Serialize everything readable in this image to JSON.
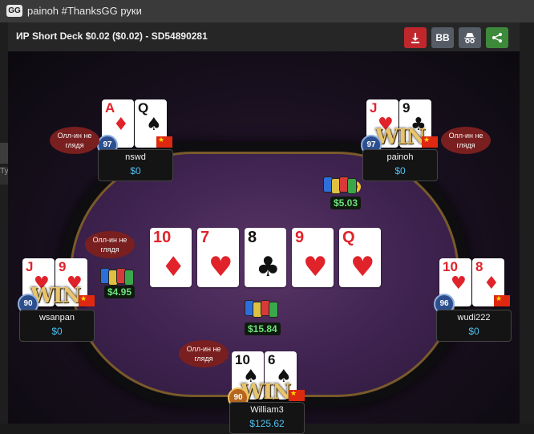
{
  "window": {
    "title": "painoh #ThanksGG руки",
    "logo_text": "GG"
  },
  "left_strip_fragment": "Ту",
  "toolbar": {
    "table_info": "ИР  Short Deck $0.02 ($0.02)   - SD54890281",
    "buttons": {
      "download_icon": "download-icon",
      "bb_label": "BB",
      "anon_icon": "incognito-icon",
      "share_icon": "share-icon"
    }
  },
  "board": [
    {
      "rank": "10",
      "suit": "♦",
      "color": "red"
    },
    {
      "rank": "7",
      "suit": "♥",
      "color": "red"
    },
    {
      "rank": "8",
      "suit": "♣",
      "color": "black"
    },
    {
      "rank": "9",
      "suit": "♥",
      "color": "red"
    },
    {
      "rank": "Q",
      "suit": "♥",
      "color": "red"
    }
  ],
  "dealer_label": "D",
  "pot": "$15.84",
  "players": {
    "nswd": {
      "name": "nswd",
      "stack": "$0",
      "level": "97",
      "bubble": "Олл-ин не глядя",
      "cards": [
        {
          "rank": "A",
          "suit": "♦",
          "color": "red"
        },
        {
          "rank": "Q",
          "suit": "♠",
          "color": "black"
        }
      ]
    },
    "painoh": {
      "name": "painoh",
      "stack": "$0",
      "level": "97",
      "bubble": "Олл-ин не глядя",
      "win": "WIN",
      "bet": "$5.03",
      "cards": [
        {
          "rank": "J",
          "suit": "♥",
          "color": "red"
        },
        {
          "rank": "9",
          "suit": "♣",
          "color": "black"
        }
      ]
    },
    "wsanpan": {
      "name": "wsanpan",
      "stack": "$0",
      "level": "90",
      "bubble": "Олл-ин не глядя",
      "win": "WIN",
      "bet": "$4.95",
      "cards": [
        {
          "rank": "J",
          "suit": "♥",
          "color": "red"
        },
        {
          "rank": "9",
          "suit": "♥",
          "color": "red"
        }
      ]
    },
    "wudi222": {
      "name": "wudi222",
      "stack": "$0",
      "level": "96",
      "cards": [
        {
          "rank": "10",
          "suit": "♥",
          "color": "red"
        },
        {
          "rank": "8",
          "suit": "♦",
          "color": "red"
        }
      ]
    },
    "william3": {
      "name": "William3",
      "stack": "$125.62",
      "level": "90",
      "bubble": "Олл-ин не глядя",
      "win": "WIN",
      "cards": [
        {
          "rank": "10",
          "suit": "♠",
          "color": "black"
        },
        {
          "rank": "6",
          "suit": "♠",
          "color": "black"
        }
      ]
    }
  },
  "colors": {
    "stack": "#4fc0f0",
    "bet": "#6ee07a",
    "download": "#c0272d",
    "share": "#3c8a3a",
    "felt": "#4a2a5a"
  }
}
